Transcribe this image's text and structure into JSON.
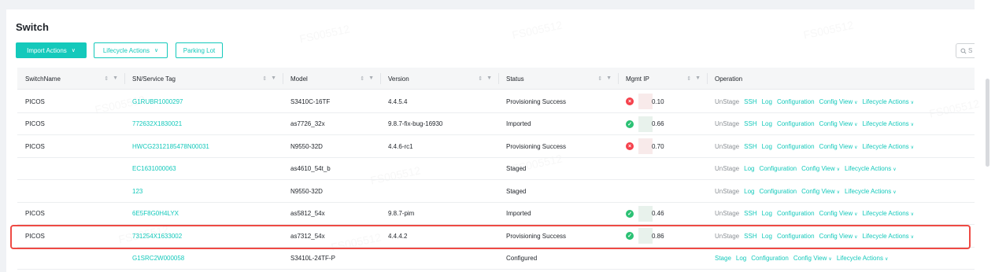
{
  "page": {
    "title": "Switch"
  },
  "toolbar": {
    "import_actions": "Import Actions",
    "lifecycle_actions": "Lifecycle Actions",
    "parking_lot": "Parking Lot",
    "search_placeholder": "S"
  },
  "columns": [
    {
      "label": "SwitchName",
      "sortable": true
    },
    {
      "label": "SN/Service Tag",
      "sortable": true
    },
    {
      "label": "Model",
      "sortable": true
    },
    {
      "label": "Version",
      "sortable": true
    },
    {
      "label": "Status",
      "sortable": true
    },
    {
      "label": "Mgmt IP",
      "sortable": true
    },
    {
      "label": "Operation",
      "sortable": false
    }
  ],
  "rows": [
    {
      "name": "PICOS",
      "sn": "G1RUBR1000297",
      "model": "S3410C-16TF",
      "version": "4.4.5.4",
      "status": "Provisioning Success",
      "ip_state": "error",
      "ip": "0.10",
      "ops": [
        "UnStage",
        "SSH",
        "Log",
        "Configuration",
        "Config View",
        "Lifecycle Actions"
      ]
    },
    {
      "name": "PICOS",
      "sn": "772632X1830021",
      "model": "as7726_32x",
      "version": "9.8.7-fix-bug-16930",
      "status": "Imported",
      "ip_state": "ok",
      "ip": "0.66",
      "ops": [
        "UnStage",
        "SSH",
        "Log",
        "Configuration",
        "Config View",
        "Lifecycle Actions"
      ]
    },
    {
      "name": "PICOS",
      "sn": "HWCG2312185478N00031",
      "model": "N9550-32D",
      "version": "4.4.6-rc1",
      "status": "Provisioning Success",
      "ip_state": "error",
      "ip": "0.70",
      "ops": [
        "UnStage",
        "SSH",
        "Log",
        "Configuration",
        "Config View",
        "Lifecycle Actions"
      ]
    },
    {
      "name": "",
      "sn": "EC1631000063",
      "model": "as4610_54t_b",
      "version": "",
      "status": "Staged",
      "ip_state": "",
      "ip": "",
      "ops": [
        "UnStage",
        "Log",
        "Configuration",
        "Config View",
        "Lifecycle Actions"
      ]
    },
    {
      "name": "",
      "sn": "123",
      "model": "N9550-32D",
      "version": "",
      "status": "Staged",
      "ip_state": "",
      "ip": "",
      "ops": [
        "UnStage",
        "Log",
        "Configuration",
        "Config View",
        "Lifecycle Actions"
      ]
    },
    {
      "name": "PICOS",
      "sn": "6E5F8G0H4LYX",
      "model": "as5812_54x",
      "version": "9.8.7-pim",
      "status": "Imported",
      "ip_state": "ok",
      "ip": "0.46",
      "ops": [
        "UnStage",
        "SSH",
        "Log",
        "Configuration",
        "Config View",
        "Lifecycle Actions"
      ]
    },
    {
      "name": "PICOS",
      "sn": "731254X1633002",
      "model": "as7312_54x",
      "version": "4.4.4.2",
      "status": "Provisioning Success",
      "ip_state": "ok",
      "ip": "0.86",
      "ops": [
        "UnStage",
        "SSH",
        "Log",
        "Configuration",
        "Config View",
        "Lifecycle Actions"
      ]
    },
    {
      "name": "",
      "sn": "G1SRC2W000058",
      "model": "S3410L-24TF-P",
      "version": "",
      "status": "Configured",
      "ip_state": "",
      "ip": "",
      "ops": [
        "Stage",
        "Log",
        "Configuration",
        "Config View",
        "Lifecycle Actions"
      ]
    }
  ],
  "watermark": "FS005512",
  "colors": {
    "accent": "#14c9bb",
    "error": "#f5414c",
    "success": "#2bc174",
    "highlight": "#ee4a44"
  }
}
